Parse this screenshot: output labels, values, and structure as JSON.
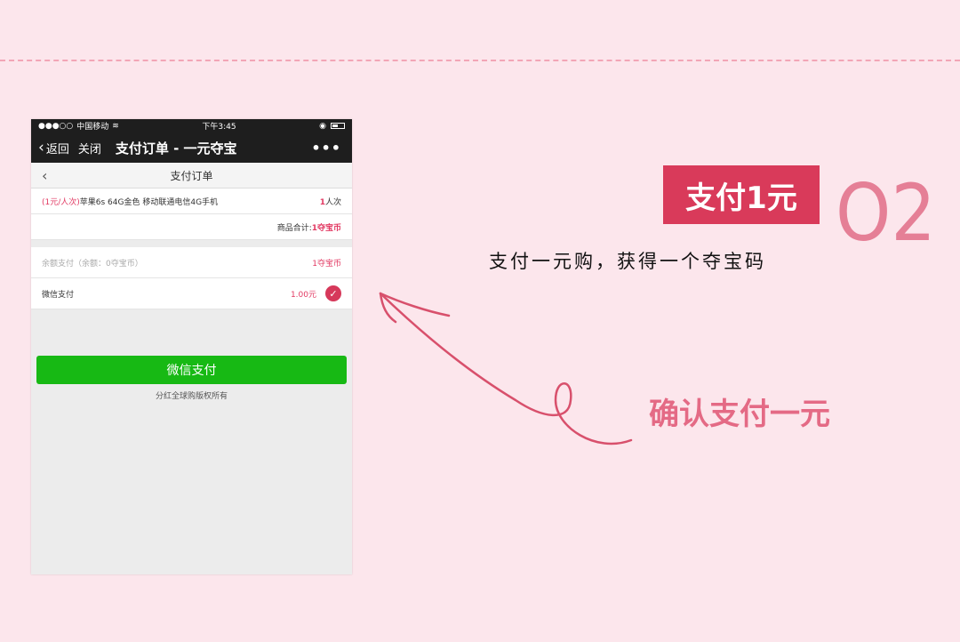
{
  "phone": {
    "status": {
      "signal": "●●●○○",
      "carrier": "中国移动",
      "time": "下午3:45"
    },
    "nav": {
      "back_label": "返回",
      "close_label": "关闭",
      "title": "支付订单 - 一元夺宝",
      "more": "•••"
    },
    "page_title": "支付订单",
    "order": {
      "product_tag": "(1元/人次)",
      "product_name": "苹果6s 64G金色 移动联通电信4G手机",
      "qty_num": "1",
      "qty_unit": "人次",
      "total_label": "商品合计:",
      "total_value": "1夺宝币"
    },
    "payment": {
      "balance_label": "余额支付（余额：0夺宝币）",
      "balance_value": "1夺宝币",
      "wechat_label": "微信支付",
      "wechat_value": "1.00元"
    },
    "pay_button": "微信支付",
    "copyright": "分红全球购版权所有"
  },
  "annotation": {
    "badge": "支付1元",
    "step": "O2",
    "subtitle": "支付一元购，获得一个夺宝码",
    "confirm": "确认支付一元"
  },
  "colors": {
    "background": "#fce6ec",
    "accent": "#d93a5a",
    "wechat_green": "#17b914"
  }
}
